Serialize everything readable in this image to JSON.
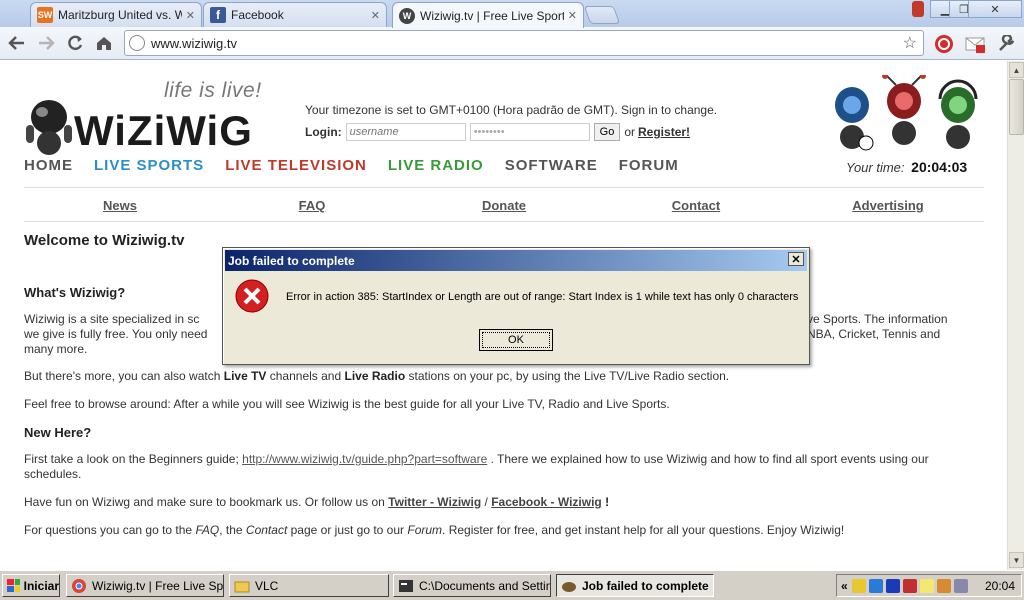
{
  "browser": {
    "tabs": [
      {
        "title": "Maritzburg United vs. Wits U",
        "favicon": "SW",
        "color": "#e8731c"
      },
      {
        "title": "Facebook",
        "favicon": "f",
        "color": "#3b5998"
      },
      {
        "title": "Wiziwig.tv | Free Live Sports",
        "favicon": "W",
        "color": "#333333"
      }
    ],
    "url": "www.wiziwig.tv"
  },
  "header": {
    "tagline": "life is live!",
    "logo_text": "WiZiWiG",
    "timezone_text": "Your timezone is set to GMT+0100 (Hora padrão de GMT). Sign in to change.",
    "login_label": "Login:",
    "username_placeholder": "username",
    "password_value": "••••••••",
    "go_label": "Go",
    "or_text": "or",
    "register_label": "Register!",
    "your_time_label": "Your time:",
    "your_time_value": "20:04:03"
  },
  "nav": {
    "items": [
      {
        "label": "HOME",
        "color": "#555555"
      },
      {
        "label": "LIVE SPORTS",
        "color": "#2b8fc6"
      },
      {
        "label": "LIVE TELEVISION",
        "color": "#c0392b"
      },
      {
        "label": "LIVE RADIO",
        "color": "#3a9a3a"
      },
      {
        "label": "SOFTWARE",
        "color": "#555555"
      },
      {
        "label": "FORUM",
        "color": "#555555"
      }
    ],
    "sub": [
      "News",
      "FAQ",
      "Donate",
      "Contact",
      "Advertising"
    ]
  },
  "content": {
    "welcome": "Welcome to Wiziwig.tv",
    "what_heading": "What's Wiziwig?",
    "what_p_start": "Wiziwig is a site specialized in sc",
    "what_p_right": "ve Sports. The information",
    "what_p_line2_start": "we give is fully free. You only need",
    "what_p_line2_right": "NBA, Cricket, Tennis and",
    "what_p_line3": "many more.",
    "more_p_1": "But there's more, you can also watch ",
    "more_p_b1": "Live TV",
    "more_p_2": " channels and ",
    "more_p_b2": "Live Radio",
    "more_p_3": " stations on your pc, by using the Live TV/Live Radio section.",
    "browse_p": "Feel free to browse around: After a while you will see Wiziwig is the best guide for all your Live TV, Radio and Live Sports.",
    "new_heading": "New Here?",
    "guide_p_1": "First take a look on the Beginners guide; ",
    "guide_link": "http://www.wiziwig.tv/guide.php?part=software",
    "guide_p_2": " . There we explained how to use Wiziwig and how to find all sport events using our schedules.",
    "fun_p_1": "Have fun on Wiziwg and make sure to bookmark us. Or follow us on ",
    "twitter_link": "Twitter - Wiziwig",
    "fun_sep": " / ",
    "facebook_link": "Facebook - Wiziwig",
    "fun_end": " !",
    "questions_1": "For questions you can go to the ",
    "questions_faq": "FAQ",
    "questions_2": ", the ",
    "questions_contact": "Contact",
    "questions_3": " page or just go to our ",
    "questions_forum": "Forum",
    "questions_4": ". Register for free, and get instant help for all your questions. Enjoy Wiziwig!"
  },
  "dialog": {
    "title": "Job failed to complete",
    "message": "Error in action 385: StartIndex or Length are out of range: Start Index is 1 while text has only 0 characters",
    "ok_label": "OK",
    "close_label": "✕"
  },
  "taskbar": {
    "start_label": "Iniciar",
    "tasks": [
      {
        "label": "Wiziwig.tv | Free Live Sp..."
      },
      {
        "label": "VLC"
      },
      {
        "label": "C:\\Documents and Settin..."
      },
      {
        "label": "Job failed to complete"
      }
    ],
    "tray_chevron": "«",
    "clock": "20:04"
  }
}
